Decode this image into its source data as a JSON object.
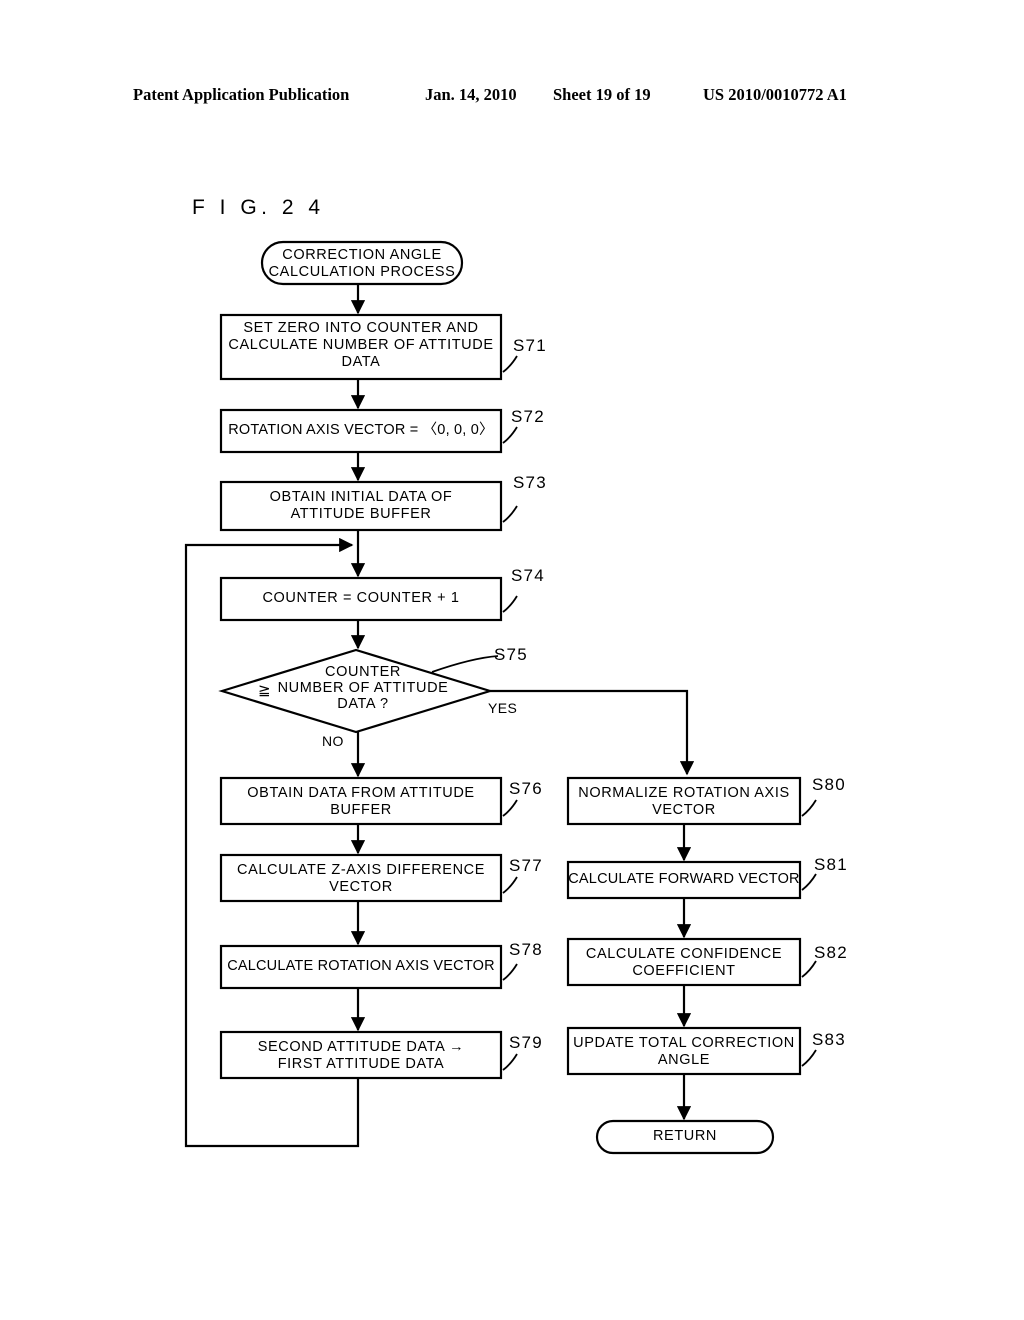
{
  "header": {
    "publication": "Patent Application Publication",
    "date": "Jan. 14, 2010",
    "sheet": "Sheet 19 of 19",
    "document_number": "US 2010/0010772 A1"
  },
  "figure": {
    "label": "F I G.  2 4"
  },
  "flowchart": {
    "start_terminal": {
      "id": "start",
      "shape": "terminator",
      "text": "CORRECTION ANGLE\nCALCULATION PROCESS"
    },
    "end_terminal": {
      "id": "return",
      "shape": "terminator",
      "text": "RETURN"
    },
    "decision": {
      "id": "S75",
      "shape": "diamond",
      "step": "S75",
      "operator": "≧",
      "text": "COUNTER\nNUMBER OF ATTITUDE\nDATA ?",
      "yes_label": "YES",
      "no_label": "NO"
    },
    "steps": [
      {
        "id": "S71",
        "step": "S71",
        "text": "SET ZERO INTO COUNTER AND\nCALCULATE NUMBER OF ATTITUDE\nDATA"
      },
      {
        "id": "S72",
        "step": "S72",
        "text": "ROTATION AXIS VECTOR = 〈0, 0, 0〉"
      },
      {
        "id": "S73",
        "step": "S73",
        "text": "OBTAIN INITIAL DATA OF\nATTITUDE BUFFER"
      },
      {
        "id": "S74",
        "step": "S74",
        "text": "COUNTER = COUNTER + 1"
      },
      {
        "id": "S76",
        "step": "S76",
        "text": "OBTAIN DATA FROM ATTITUDE\nBUFFER"
      },
      {
        "id": "S77",
        "step": "S77",
        "text": "CALCULATE Z-AXIS DIFFERENCE\nVECTOR"
      },
      {
        "id": "S78",
        "step": "S78",
        "text": "CALCULATE ROTATION AXIS VECTOR"
      },
      {
        "id": "S79",
        "step": "S79",
        "text": "SECOND ATTITUDE DATA →\nFIRST ATTITUDE DATA"
      },
      {
        "id": "S80",
        "step": "S80",
        "text": "NORMALIZE ROTATION AXIS\nVECTOR"
      },
      {
        "id": "S81",
        "step": "S81",
        "text": "CALCULATE FORWARD VECTOR"
      },
      {
        "id": "S82",
        "step": "S82",
        "text": "CALCULATE CONFIDENCE\nCOEFFICIENT"
      },
      {
        "id": "S83",
        "step": "S83",
        "text": "UPDATE TOTAL CORRECTION\nANGLE"
      }
    ]
  },
  "colors": {
    "ink": "#000000",
    "paper": "#ffffff"
  }
}
